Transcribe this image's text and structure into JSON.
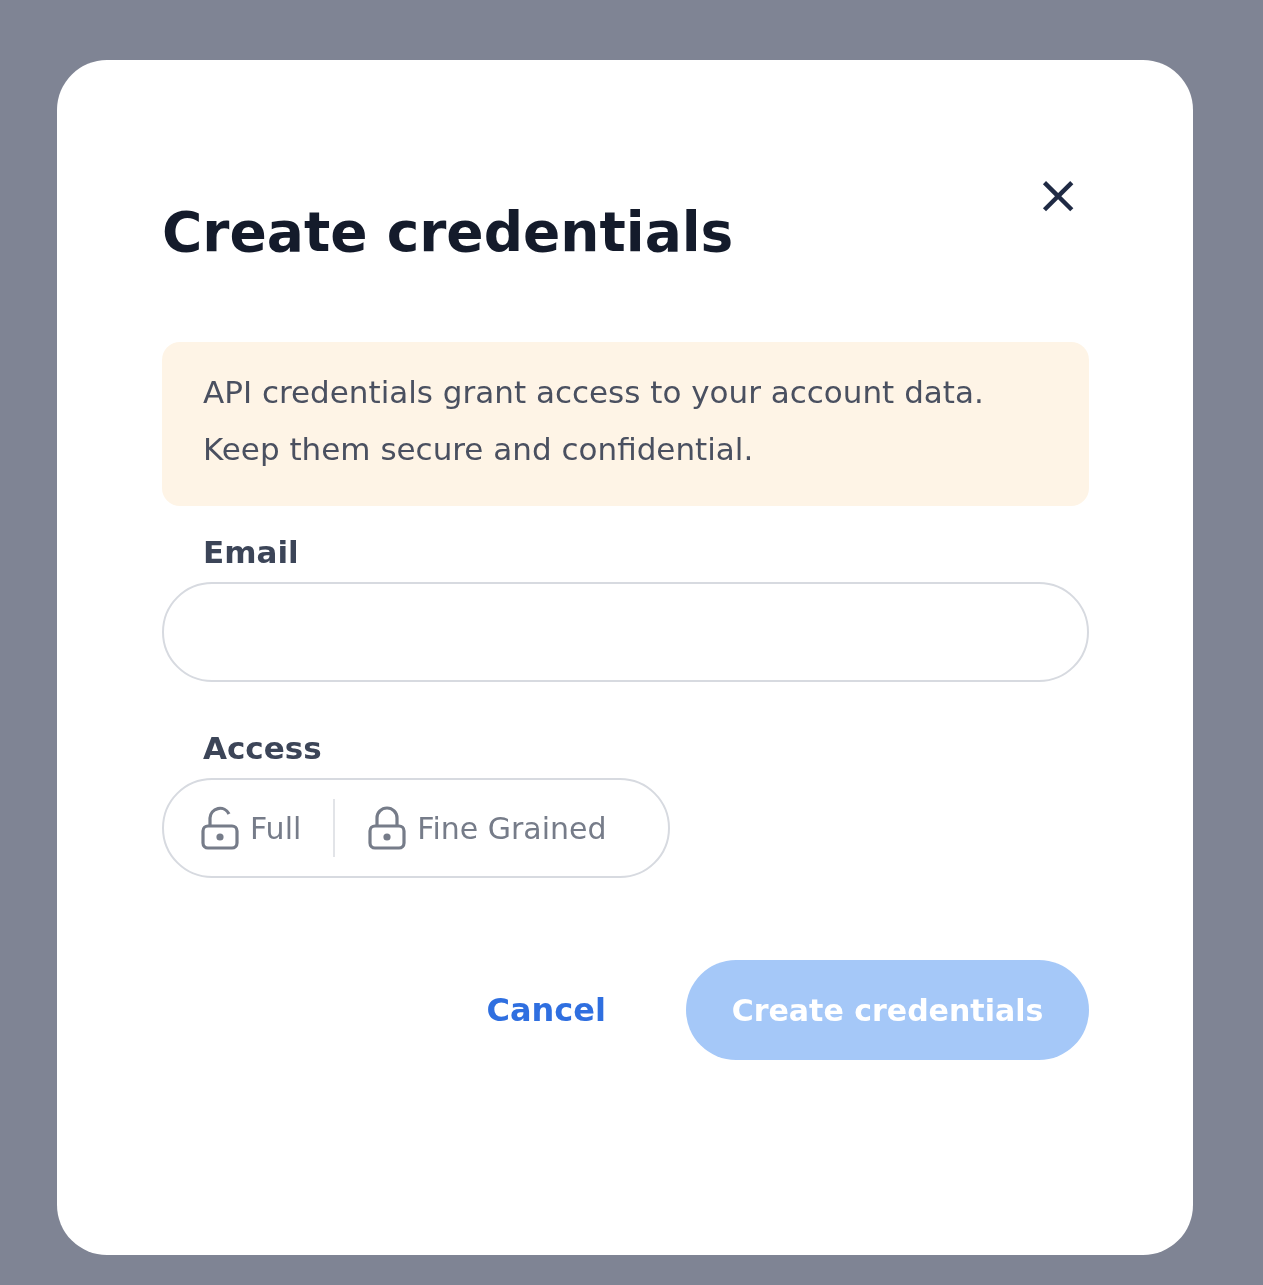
{
  "dialog": {
    "title": "Create credentials",
    "close": "×"
  },
  "notice": "API credentials grant access to your account data. Keep them secure and confidential.",
  "email": {
    "label": "Email"
  },
  "access": {
    "label": "Access",
    "options": [
      {
        "label": "Full",
        "kind": "unlocked",
        "selected": false
      },
      {
        "label": "Fine Grained",
        "kind": "locked",
        "selected": false
      }
    ]
  },
  "actions": {
    "cancel": "Cancel",
    "submit": {
      "label": "Create credentials",
      "disabled": true
    }
  }
}
